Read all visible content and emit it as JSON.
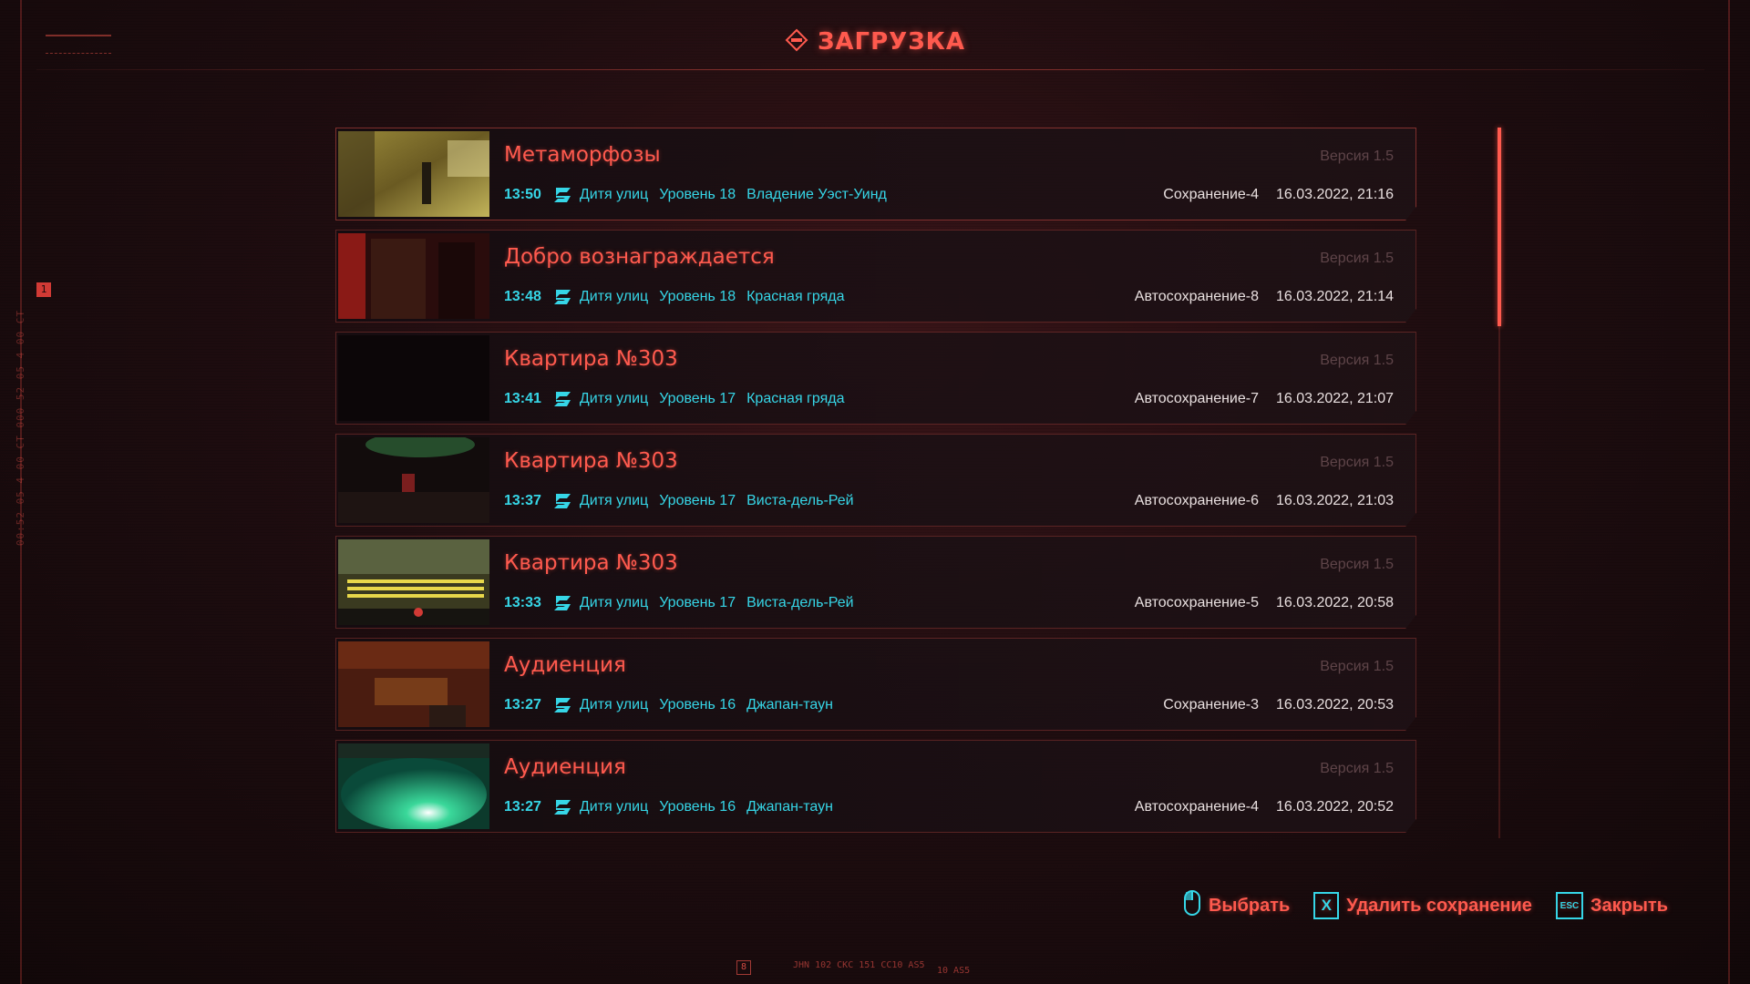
{
  "header": {
    "title": "ЗАГРУЗКА"
  },
  "side": {
    "badge": "1",
    "code": "00:52 05 4 00 CT 000 52 05 4 00 CT"
  },
  "saves": [
    {
      "title": "Метаморфозы",
      "time": "13:50",
      "lifepath": "Дитя улиц",
      "level": "Уровень 18",
      "location": "Владение Уэст-Уинд",
      "version": "Версия 1.5",
      "save_name": "Сохранение-4",
      "date": "16.03.2022, 21:16"
    },
    {
      "title": "Добро вознаграждается",
      "time": "13:48",
      "lifepath": "Дитя улиц",
      "level": "Уровень 18",
      "location": "Красная гряда",
      "version": "Версия 1.5",
      "save_name": "Автосохранение-8",
      "date": "16.03.2022, 21:14"
    },
    {
      "title": "Квартира №303",
      "time": "13:41",
      "lifepath": "Дитя улиц",
      "level": "Уровень 17",
      "location": "Красная гряда",
      "version": "Версия 1.5",
      "save_name": "Автосохранение-7",
      "date": "16.03.2022, 21:07"
    },
    {
      "title": "Квартира №303",
      "time": "13:37",
      "lifepath": "Дитя улиц",
      "level": "Уровень 17",
      "location": "Виста-дель-Рей",
      "version": "Версия 1.5",
      "save_name": "Автосохранение-6",
      "date": "16.03.2022, 21:03"
    },
    {
      "title": "Квартира №303",
      "time": "13:33",
      "lifepath": "Дитя улиц",
      "level": "Уровень 17",
      "location": "Виста-дель-Рей",
      "version": "Версия 1.5",
      "save_name": "Автосохранение-5",
      "date": "16.03.2022, 20:58"
    },
    {
      "title": "Аудиенция",
      "time": "13:27",
      "lifepath": "Дитя улиц",
      "level": "Уровень 16",
      "location": "Джапан-таун",
      "version": "Версия 1.5",
      "save_name": "Сохранение-3",
      "date": "16.03.2022, 20:53"
    },
    {
      "title": "Аудиенция",
      "time": "13:27",
      "lifepath": "Дитя улиц",
      "level": "Уровень 16",
      "location": "Джапан-таун",
      "version": "Версия 1.5",
      "save_name": "Автосохранение-4",
      "date": "16.03.2022, 20:52"
    }
  ],
  "actions": {
    "select": "Выбрать",
    "delete_key": "X",
    "delete": "Удалить сохранение",
    "close_key": "ESC",
    "close": "Закрыть"
  },
  "footer": {
    "badge": "8",
    "code": "JHN 102 CKC 151 CC10 AS5",
    "code2": "10 AS5"
  },
  "colors": {
    "accent": "#ff5a4e",
    "teal": "#36d6e7",
    "text": "#e9e0e0",
    "muted": "#5e4448"
  }
}
